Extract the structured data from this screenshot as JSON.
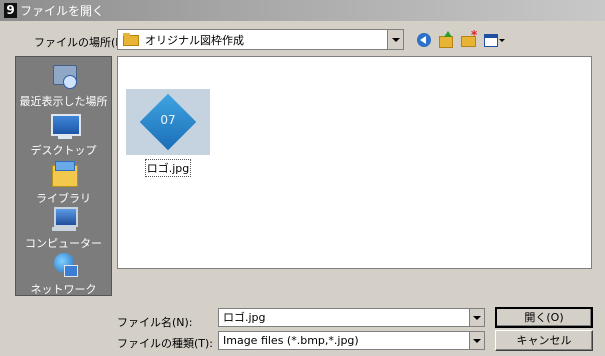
{
  "window": {
    "title": "ファイルを開く",
    "app_icon": "9"
  },
  "lookin": {
    "label": "ファイルの場所(I):",
    "value": "オリジナル図枠作成"
  },
  "places": [
    {
      "label": "最近表示した場所",
      "icon": "recent-places-icon"
    },
    {
      "label": "デスクトップ",
      "icon": "desktop-icon"
    },
    {
      "label": "ライブラリ",
      "icon": "library-icon"
    },
    {
      "label": "コンピューター",
      "icon": "computer-icon"
    },
    {
      "label": "ネットワーク",
      "icon": "network-icon"
    }
  ],
  "files": [
    {
      "name": "ロゴ.jpg",
      "thumb_text": "07"
    }
  ],
  "filename": {
    "label": "ファイル名(N):",
    "value": "ロゴ.jpg"
  },
  "filetype": {
    "label": "ファイルの種類(T):",
    "value": "Image files (*.bmp,*.jpg)"
  },
  "buttons": {
    "open": "開く(O)",
    "cancel": "キャンセル"
  }
}
